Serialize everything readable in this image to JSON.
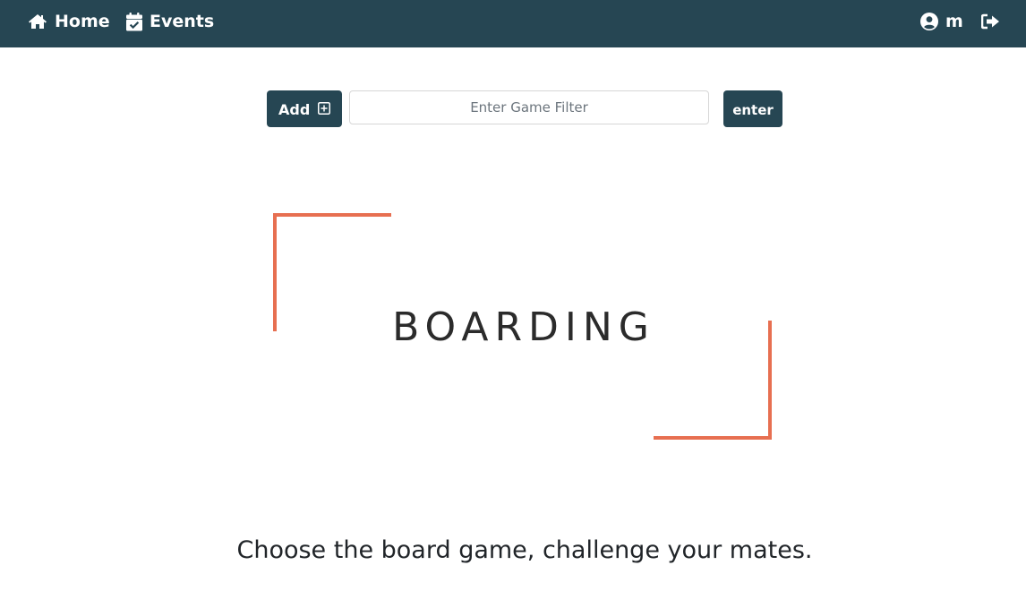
{
  "colors": {
    "navbar_bg": "#264653",
    "button_bg": "#264653",
    "logo_accent": "#e76f51",
    "text_dark": "#212529"
  },
  "navbar": {
    "home": {
      "label": "Home",
      "icon": "home-icon"
    },
    "events": {
      "label": "Events",
      "icon": "calendar-check-icon"
    },
    "user": {
      "label": "m",
      "icon": "user-circle-icon"
    },
    "logout": {
      "icon": "sign-out-icon"
    }
  },
  "toolbar": {
    "add_label": "Add",
    "add_icon": "plus-square-icon",
    "filter_placeholder": "Enter Game Filter",
    "filter_value": "",
    "enter_label": "enter"
  },
  "brand": {
    "word": "BOARDING"
  },
  "tagline": "Choose the board game, challenge your mates."
}
